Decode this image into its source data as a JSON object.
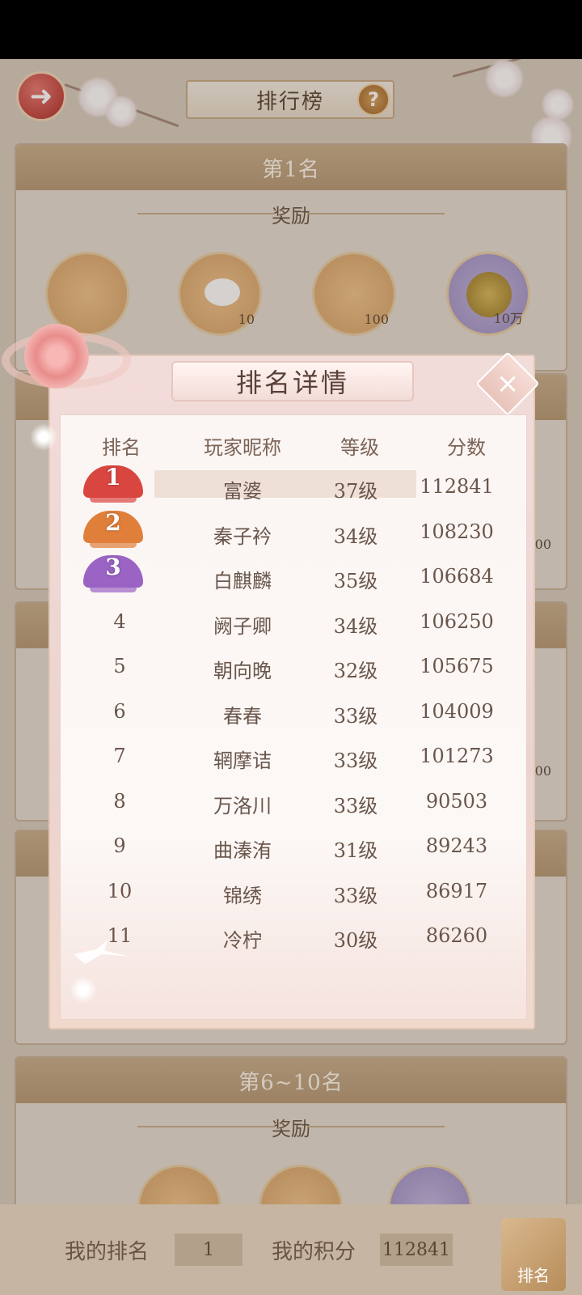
{
  "header": {
    "title": "排行榜",
    "back_icon": "arrow-left-icon",
    "help_label": "?"
  },
  "cards": [
    {
      "title": "第1名",
      "reward_label": "奖励",
      "items": [
        {
          "name": "gift-box-icon",
          "count": ""
        },
        {
          "name": "rice-cake-icon",
          "count": "10"
        },
        {
          "name": "golden-ornament-icon",
          "count": "100"
        },
        {
          "name": "paw-coin-icon",
          "count": "10万"
        }
      ]
    },
    {
      "title": "第6~10名",
      "reward_label": "奖励"
    }
  ],
  "side_counts": [
    "00",
    "00"
  ],
  "modal": {
    "title": "排名详情",
    "close_label": "×",
    "columns": [
      "排名",
      "玩家昵称",
      "等级",
      "分数"
    ],
    "rows": [
      {
        "rank": "1",
        "name": "富婆",
        "level": "37级",
        "score": "112841"
      },
      {
        "rank": "2",
        "name": "秦子衿",
        "level": "34级",
        "score": "108230"
      },
      {
        "rank": "3",
        "name": "白麒麟",
        "level": "35级",
        "score": "106684"
      },
      {
        "rank": "4",
        "name": "阙子卿",
        "level": "34级",
        "score": "106250"
      },
      {
        "rank": "5",
        "name": "朝向晚",
        "level": "32级",
        "score": "105675"
      },
      {
        "rank": "6",
        "name": "春春",
        "level": "33级",
        "score": "104009"
      },
      {
        "rank": "7",
        "name": "辋摩诘",
        "level": "33级",
        "score": "101273"
      },
      {
        "rank": "8",
        "name": "万洛川",
        "level": "33级",
        "score": "90503"
      },
      {
        "rank": "9",
        "name": "曲溱洧",
        "level": "31级",
        "score": "89243"
      },
      {
        "rank": "10",
        "name": "锦绣",
        "level": "33级",
        "score": "86917"
      },
      {
        "rank": "11",
        "name": "冷柠",
        "level": "30级",
        "score": "86260"
      }
    ]
  },
  "footer": {
    "my_rank_label": "我的排名",
    "my_rank_value": "1",
    "my_score_label": "我的积分",
    "my_score_value": "112841",
    "rank_button_label": "排名"
  },
  "colors": {
    "medal_gold": "#d9453f",
    "medal_silver": "#e07f3a",
    "medal_bronze": "#9a63c4",
    "accent": "#c8ad8c"
  }
}
